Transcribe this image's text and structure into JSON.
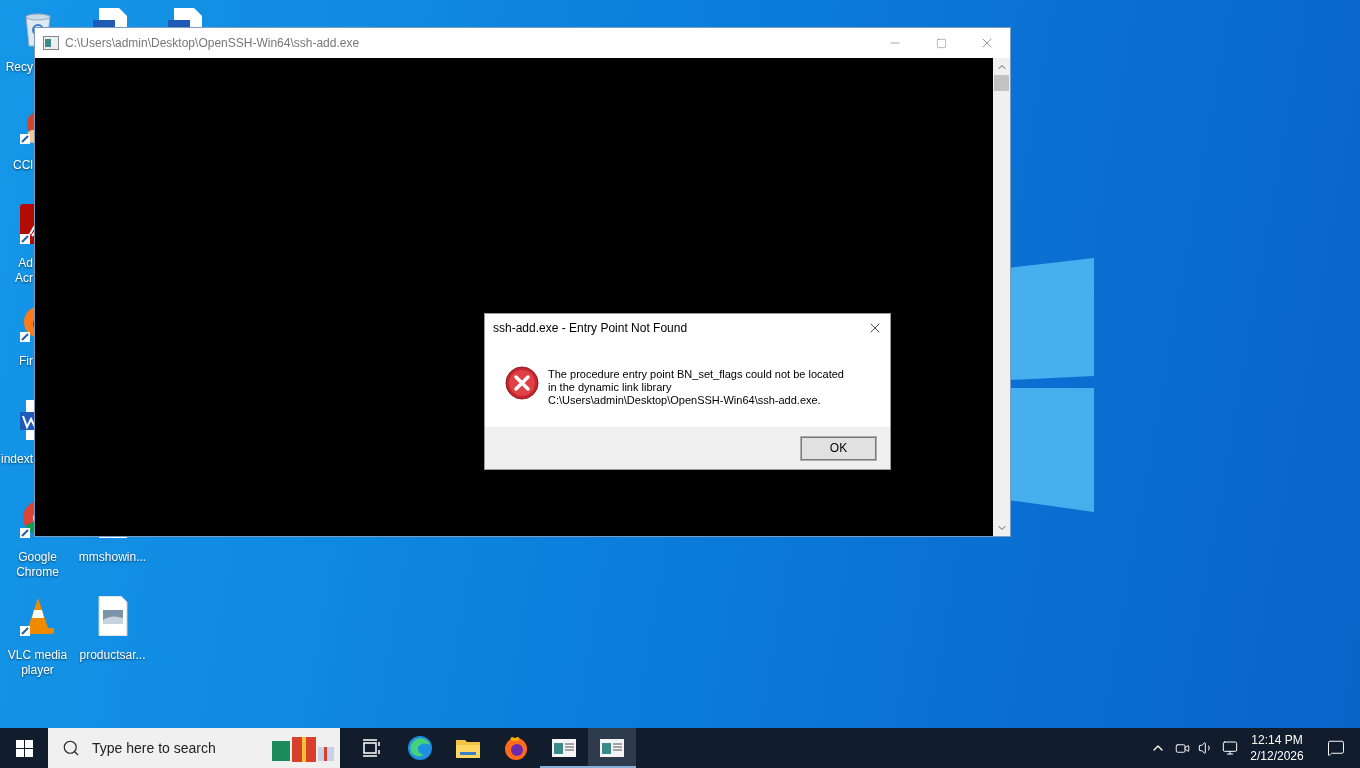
{
  "desktop": {
    "icons": [
      {
        "label": "Recy",
        "covered": true
      },
      {
        "label": "CCl",
        "covered": true
      },
      {
        "label": "Ad\nAcr",
        "covered": true
      },
      {
        "label": "Fir",
        "covered": true
      },
      {
        "label": "indext",
        "covered": true
      },
      {
        "label": "Google Chrome",
        "covered": false
      },
      {
        "label": "VLC media player",
        "covered": false
      },
      {
        "label": "mmshowin...",
        "covered": false
      },
      {
        "label": "productsar...",
        "covered": false
      }
    ]
  },
  "console_window": {
    "title": "C:\\Users\\admin\\Desktop\\OpenSSH-Win64\\ssh-add.exe"
  },
  "dialog": {
    "title": "ssh-add.exe - Entry Point Not Found",
    "message": [
      "The procedure entry point BN_set_flags could not be located",
      "in the dynamic link library",
      "C:\\Users\\admin\\Desktop\\OpenSSH-Win64\\ssh-add.exe."
    ],
    "button": "OK"
  },
  "taskbar": {
    "search": {
      "placeholder": "Type here to search"
    },
    "apps": [
      {
        "running": false,
        "selected": false
      },
      {
        "running": false,
        "selected": false
      },
      {
        "running": false,
        "selected": false
      },
      {
        "running": false,
        "selected": false
      },
      {
        "running": true,
        "selected": false
      },
      {
        "running": true,
        "selected": true
      }
    ],
    "clock": {
      "time": "12:14 PM",
      "date": "2/12/2026"
    }
  }
}
